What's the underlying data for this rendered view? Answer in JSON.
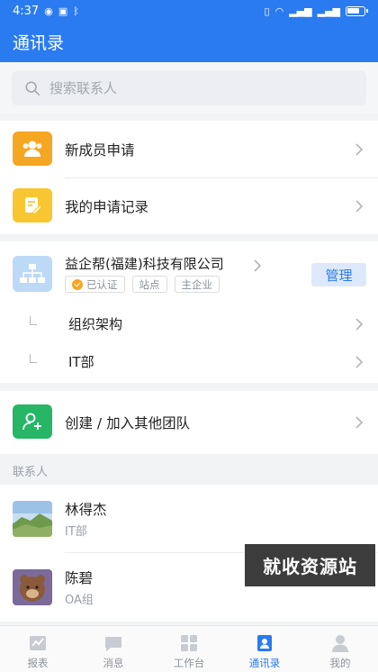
{
  "status_bar": {
    "time": "4:37"
  },
  "header": {
    "title": "通讯录"
  },
  "search": {
    "placeholder": "搜索联系人"
  },
  "quick_actions": [
    {
      "label": "新成员申请",
      "icon": "users-icon",
      "color": "#f5a623"
    },
    {
      "label": "我的申请记录",
      "icon": "edit-icon",
      "color": "#f7c631"
    }
  ],
  "organization": {
    "name": "益企帮(福建)科技有限公司",
    "tags": [
      "已认证",
      "站点",
      "主企业"
    ],
    "manage_label": "管理",
    "sub_items": [
      "组织架构",
      "IT部"
    ]
  },
  "team_action": {
    "label": "创建 / 加入其他团队",
    "color": "#27b566"
  },
  "contacts_section": {
    "title": "联系人",
    "contacts": [
      {
        "name": "林得杰",
        "dept": "IT部"
      },
      {
        "name": "陈碧",
        "dept": "OA组"
      }
    ]
  },
  "watermark": "就收资源站",
  "tab_bar": {
    "tabs": [
      {
        "label": "报表",
        "icon": "report-icon",
        "active": false
      },
      {
        "label": "消息",
        "icon": "chat-icon",
        "active": false
      },
      {
        "label": "工作台",
        "icon": "grid-icon",
        "active": false
      },
      {
        "label": "通讯录",
        "icon": "contacts-icon",
        "active": true
      },
      {
        "label": "我的",
        "icon": "person-icon",
        "active": false
      }
    ]
  },
  "accent_color": "#2b7bf0"
}
